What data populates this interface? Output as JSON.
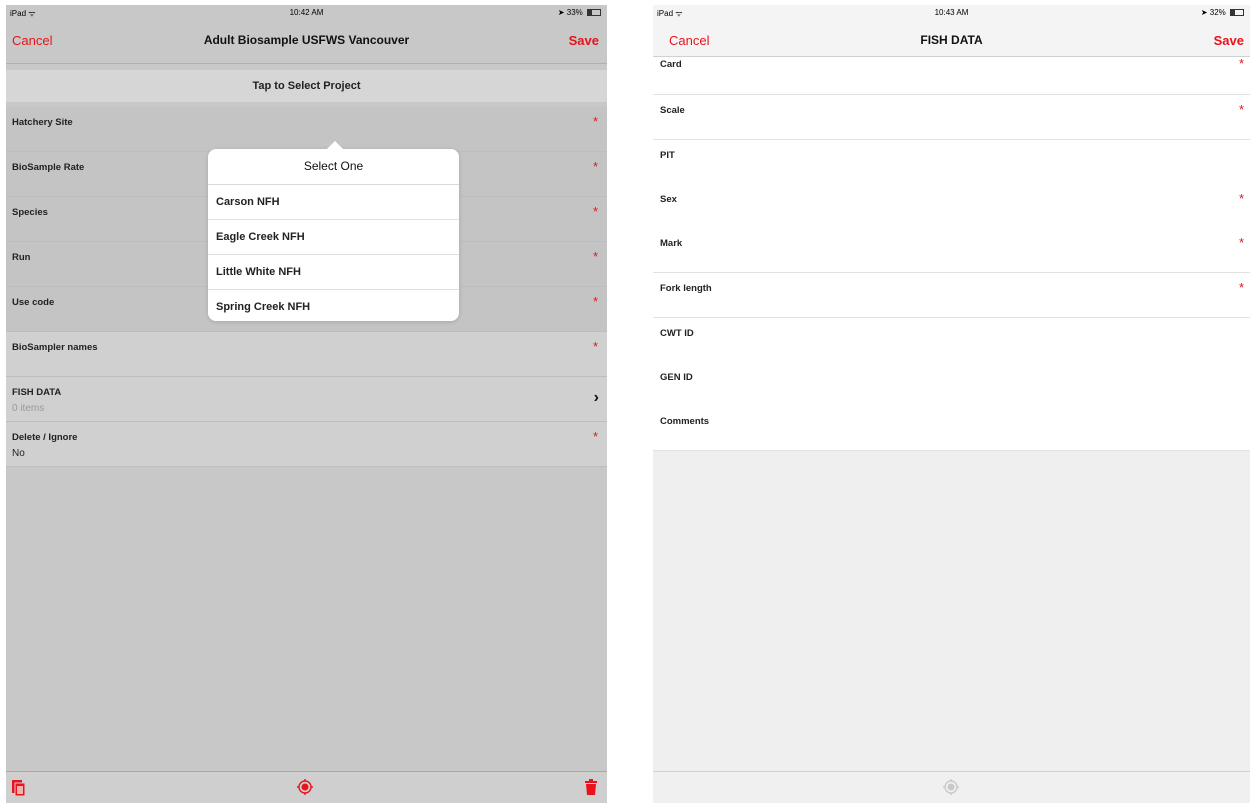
{
  "left": {
    "status": {
      "carrier": "iPad ᯤ",
      "time": "10:42 AM",
      "battery": "33%"
    },
    "nav": {
      "cancel": "Cancel",
      "title": "Adult Biosample USFWS Vancouver",
      "save": "Save"
    },
    "project_button": "Tap to Select Project",
    "fields": [
      {
        "label": "Hatchery Site",
        "required": "*"
      },
      {
        "label": "BioSample Rate",
        "required": "*"
      },
      {
        "label": "Species",
        "required": "*"
      },
      {
        "label": "Run",
        "required": "*"
      },
      {
        "label": "Use code",
        "required": "*"
      },
      {
        "label": "BioSampler names",
        "required": "*"
      },
      {
        "label": "FISH DATA",
        "value": "0 items",
        "chevron": "›"
      },
      {
        "label": "Delete / Ignore",
        "value": "No",
        "required": "*"
      }
    ],
    "popover": {
      "title": "Select One",
      "options": [
        "Carson NFH",
        "Eagle Creek NFH",
        "Little White NFH",
        "Spring Creek NFH"
      ]
    },
    "toolbar": {
      "icons": [
        "copy-icon",
        "location-icon",
        "trash-icon"
      ]
    }
  },
  "right": {
    "status": {
      "carrier": "iPad ᯤ",
      "time": "10:43 AM",
      "battery": "32%"
    },
    "nav": {
      "cancel": "Cancel",
      "title": "FISH DATA",
      "save": "Save"
    },
    "fields": [
      {
        "label": "Card",
        "required": "*"
      },
      {
        "label": "Scale",
        "required": "*"
      },
      {
        "label": "PIT"
      },
      {
        "label": "Sex",
        "required": "*"
      },
      {
        "label": "Mark",
        "required": "*"
      },
      {
        "label": "Fork length",
        "required": "*"
      },
      {
        "label": "CWT ID"
      },
      {
        "label": "GEN ID"
      },
      {
        "label": "Comments"
      }
    ],
    "toolbar": {
      "icons": [
        "location-icon"
      ]
    }
  },
  "colors": {
    "accent": "#e8131b",
    "left_background": "#c8c8c8",
    "right_background": "#efefef"
  }
}
